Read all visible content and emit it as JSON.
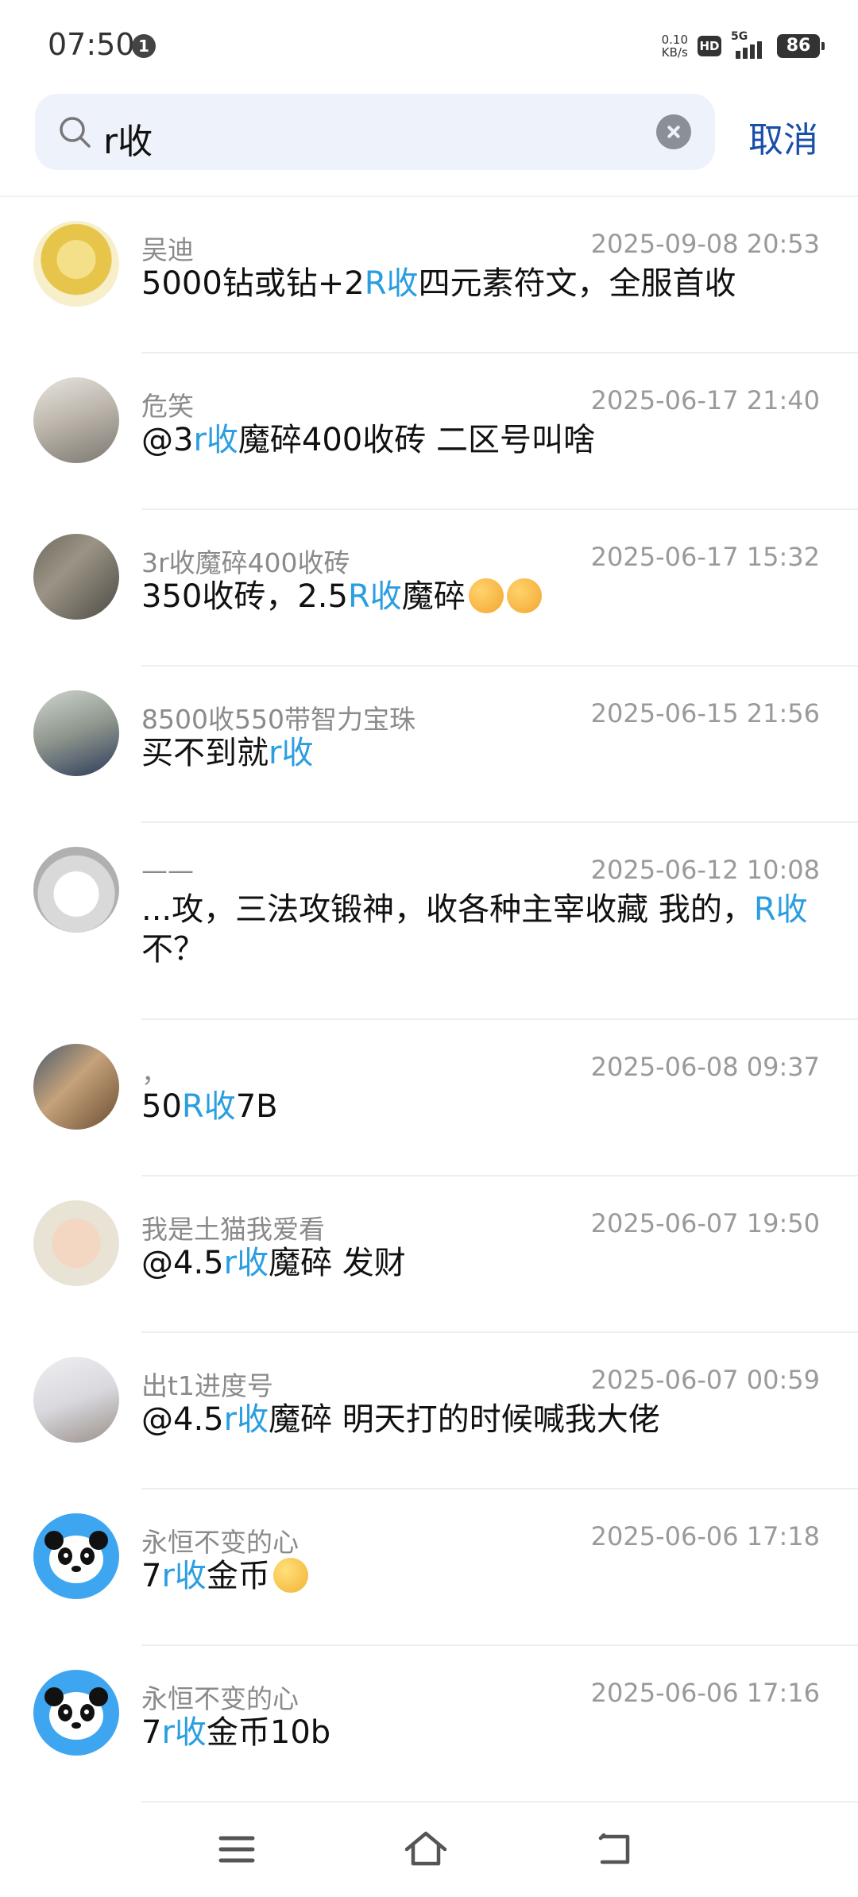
{
  "status_bar": {
    "time": "07:50",
    "notification_count": "1",
    "net_speed_value": "0.10",
    "net_speed_unit": "KB/s",
    "hd_label": "HD",
    "network_label": "5G",
    "battery": "86"
  },
  "search": {
    "value": "r收",
    "cancel_label": "取消"
  },
  "colors": {
    "highlight": "#2a9ee0",
    "accent": "#1a4fa8"
  },
  "results": [
    {
      "name": "吴迪",
      "time": "2025-09-08 20:53",
      "msg": [
        {
          "t": "5000钻或钻+2"
        },
        {
          "t": "R收",
          "hl": true
        },
        {
          "t": "四元素符文，全服首收"
        }
      ]
    },
    {
      "name": "危笑",
      "time": "2025-06-17 21:40",
      "msg": [
        {
          "t": "@3"
        },
        {
          "t": "r收",
          "hl": true
        },
        {
          "t": "魔碎400收砖  二区号叫啥"
        }
      ]
    },
    {
      "name": "3r收魔碎400收砖",
      "time": "2025-06-17 15:32",
      "msg": [
        {
          "t": "350收砖，2.5"
        },
        {
          "t": "R收",
          "hl": true
        },
        {
          "t": "魔碎"
        },
        {
          "emoji": "smiling-hearts-emoji"
        },
        {
          "emoji": "smiling-hearts-emoji"
        }
      ]
    },
    {
      "name": "8500收550带智力宝珠",
      "time": "2025-06-15 21:56",
      "msg": [
        {
          "t": "买不到就"
        },
        {
          "t": "r收",
          "hl": true
        }
      ]
    },
    {
      "name": "——",
      "time": "2025-06-12 10:08",
      "msg": [
        {
          "t": "...攻，三法攻锻神，收各种主宰收藏  我的，"
        },
        {
          "t": "R收",
          "hl": true
        },
        {
          "t": "不？"
        }
      ]
    },
    {
      "name": "，",
      "time": "2025-06-08 09:37",
      "msg": [
        {
          "t": "50"
        },
        {
          "t": "R收",
          "hl": true
        },
        {
          "t": "7B"
        }
      ]
    },
    {
      "name": "我是土猫我爱看",
      "time": "2025-06-07 19:50",
      "msg": [
        {
          "t": "@4.5"
        },
        {
          "t": "r收",
          "hl": true
        },
        {
          "t": "魔碎  发财"
        }
      ]
    },
    {
      "name": "出t1进度号",
      "time": "2025-06-07 00:59",
      "msg": [
        {
          "t": "@4.5"
        },
        {
          "t": "r收",
          "hl": true
        },
        {
          "t": "魔碎  明天打的时候喊我大佬"
        }
      ]
    },
    {
      "name": "永恒不变的心",
      "time": "2025-06-06 17:18",
      "msg": [
        {
          "t": "7"
        },
        {
          "t": "r收",
          "hl": true
        },
        {
          "t": "金币"
        },
        {
          "emoji": "tears-of-joy-emoji"
        }
      ]
    },
    {
      "name": "永恒不变的心",
      "time": "2025-06-06 17:16",
      "msg": [
        {
          "t": "7"
        },
        {
          "t": "r收",
          "hl": true
        },
        {
          "t": "金币10b"
        }
      ]
    }
  ],
  "icons": {
    "search": "search-icon",
    "clear": "clear-icon",
    "menu": "menu-icon",
    "home": "home-icon",
    "back": "back-icon"
  }
}
